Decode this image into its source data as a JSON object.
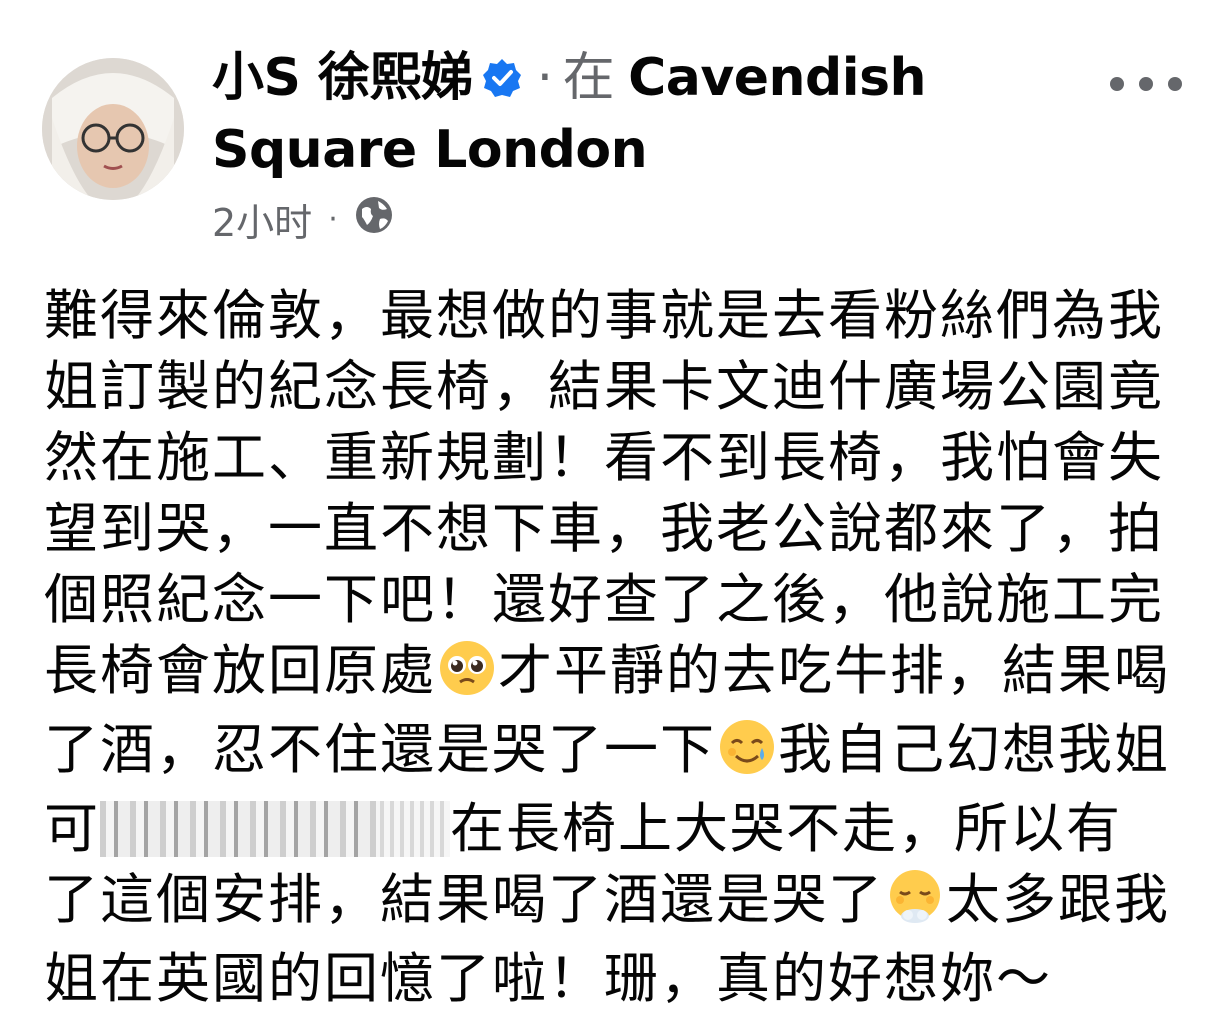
{
  "post": {
    "author": "小S 徐熙娣",
    "location_prefix": "在",
    "location": "Cavendish Square London",
    "timestamp": "2小时",
    "privacy_icon": "globe-icon",
    "verified_icon": "verified-badge-icon",
    "more_icon": "more-options-icon",
    "text_part1": "難得來倫敦，最想做的事就是去看粉絲們為我姐訂製的紀念長椅，結果卡文迪什廣場公園竟然在施工、重新規劃！看不到長椅，我怕會失望到哭，一直不想下車，我老公說都來了，拍個照紀念一下吧！還好查了之後，他說施工完長椅會放回原處",
    "text_part2": "才平靜的去吃牛排，結果喝了酒，忍不住還是哭了一下",
    "text_part3": "我自己幻想我姐可",
    "text_part4": "在長椅上大哭不走，所以有了這個安排，結果喝了酒還是哭了",
    "text_part5": "太多跟我姐在英國的回憶了啦！珊，真的好想妳～",
    "emoji1": "pleading-face-emoji",
    "emoji2": "smiling-face-with-tear-emoji",
    "emoji3": "face-exhaling-emoji",
    "colors": {
      "verified": "#1877f2",
      "meta": "#65676b",
      "text": "#050505"
    }
  }
}
